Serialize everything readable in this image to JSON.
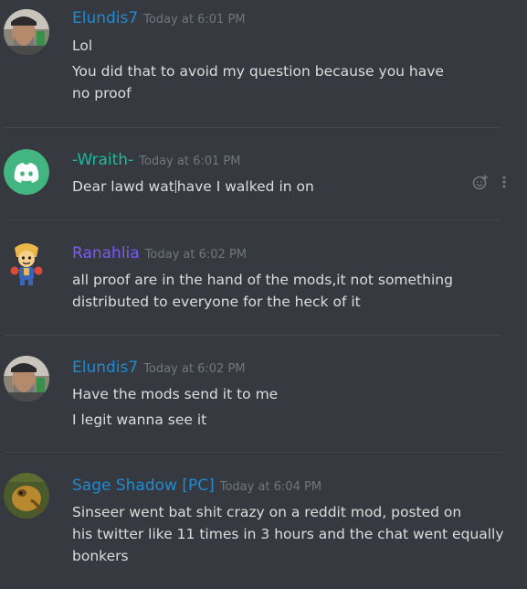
{
  "colors": {
    "background": "#36393f",
    "elundis": "#1f8bd1",
    "wraith": "#1abc9c",
    "ranahlia": "#7c5cf0",
    "sage": "#1f8bd1",
    "timestamp": "#72767d",
    "text": "#dcddde"
  },
  "messages": [
    {
      "username": "Elundis7",
      "timestamp": "Today at 6:01 PM",
      "avatar_icon": "bearded-man-avatar",
      "lines": [
        "Lol",
        "You did that to avoid my question because you have",
        "no proof"
      ]
    },
    {
      "username": "-Wraith-",
      "timestamp": "Today at 6:01 PM",
      "avatar_icon": "discord-default-avatar",
      "line_before_cursor": "Dear lawd wat",
      "line_after_cursor": "have I walked in on"
    },
    {
      "username": "Ranahlia",
      "timestamp": "Today at 6:02 PM",
      "avatar_icon": "cartoon-character-avatar",
      "lines": [
        "all proof are in the hand of the mods,it not something",
        "distributed to everyone for the heck of it"
      ]
    },
    {
      "username": "Elundis7",
      "timestamp": "Today at 6:02 PM",
      "avatar_icon": "bearded-man-avatar",
      "lines": [
        "Have the mods send it to me",
        "I legit wanna see it"
      ]
    },
    {
      "username": "Sage Shadow [PC]",
      "timestamp": "Today at 6:04 PM",
      "avatar_icon": "animal-avatar",
      "lines": [
        "Sinseer went bat shit crazy on a reddit mod,  posted on",
        "his twitter like 11 times in 3 hours and the chat went equally",
        "bonkers"
      ]
    }
  ],
  "hover_tools": {
    "reaction_icon": "add-reaction-icon",
    "more_icon": "more-options-icon"
  }
}
